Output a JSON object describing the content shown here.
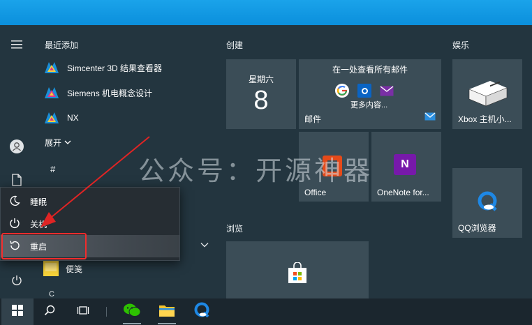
{
  "left_rail": {
    "menu_icon": "hamburger-icon",
    "user_icon": "user-icon",
    "documents_icon": "document-icon",
    "power_icon": "power-icon"
  },
  "applist": {
    "recent_heading": "最近添加",
    "recent_apps": [
      {
        "label": "Simcenter 3D 结果查看器",
        "icon": "nx-icon"
      },
      {
        "label": "Siemens 机电概念设计",
        "icon": "nx-icon"
      },
      {
        "label": "NX",
        "icon": "nx-icon"
      }
    ],
    "expand_label": "展开",
    "expand_chevron": "chevron-down-icon",
    "letter_hash": "#",
    "sticky_notes_label": "便笺",
    "letter_c": "C"
  },
  "power_menu": {
    "items": [
      {
        "label": "睡眠",
        "icon": "moon-icon"
      },
      {
        "label": "关机",
        "icon": "power-icon"
      },
      {
        "label": "重启",
        "icon": "restart-icon"
      }
    ]
  },
  "tiles": {
    "group_create": "创建",
    "group_entertainment": "娱乐",
    "group_browse": "浏览",
    "calendar": {
      "weekday": "星期六",
      "day": "8"
    },
    "mail": {
      "header": "在一处查看所有邮件",
      "more": "更多内容...",
      "label": "邮件"
    },
    "xbox": {
      "label": "Xbox 主机小..."
    },
    "office": {
      "label": "Office"
    },
    "onenote": {
      "label": "OneNote for..."
    },
    "qq_browser": {
      "label": "QQ浏览器"
    },
    "store": {
      "label": ""
    }
  },
  "watermark": "公众号：开源神器",
  "colors": {
    "highlight_red": "#f22c2c",
    "accent_blue": "#0b8fdc",
    "tile_bg": "#3b4d57",
    "panel_bg": "#23353f"
  }
}
